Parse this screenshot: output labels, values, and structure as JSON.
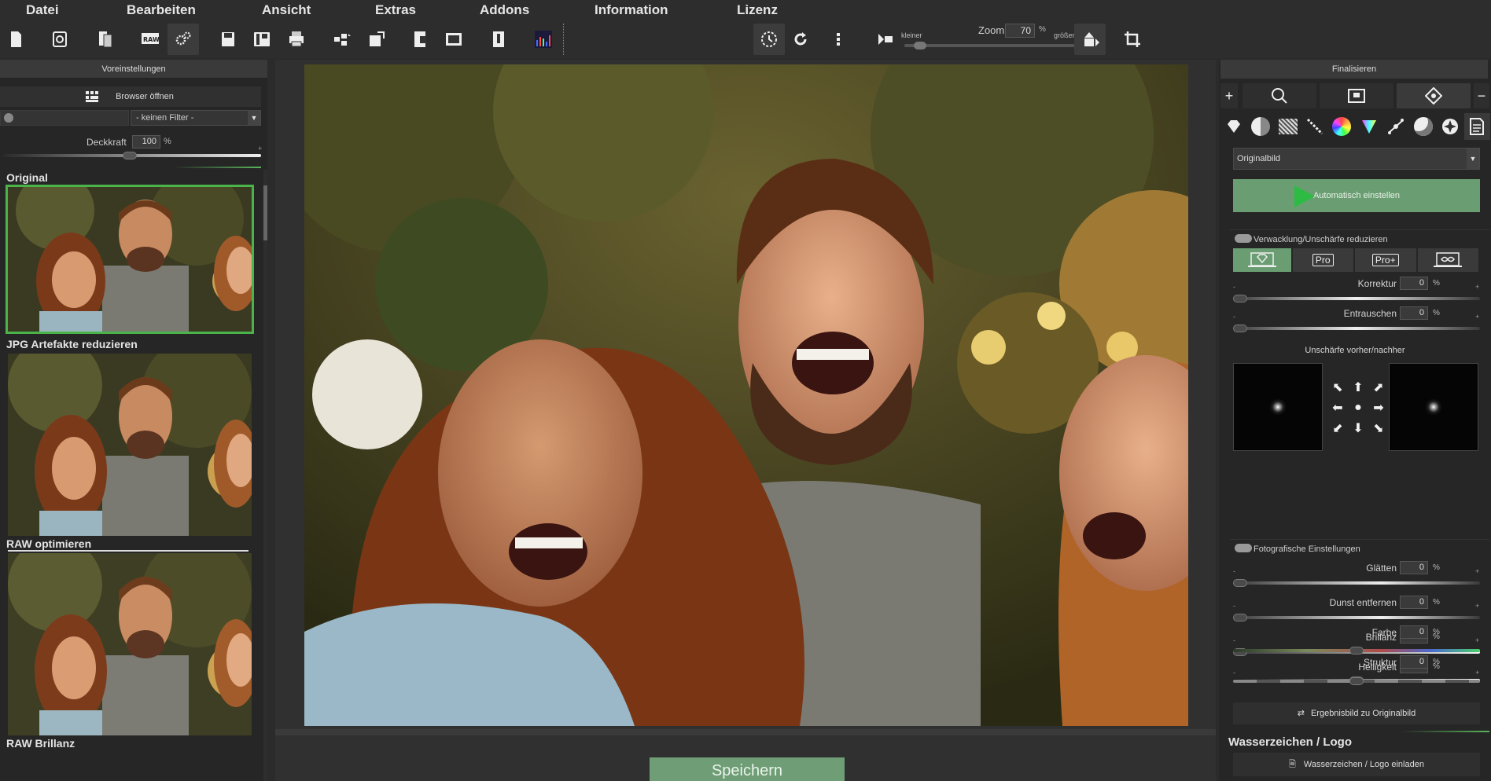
{
  "menu": {
    "items": [
      "Datei",
      "Bearbeiten",
      "Ansicht",
      "Extras",
      "Addons",
      "Information",
      "Lizenz"
    ]
  },
  "toolbar": {
    "zoom_label": "Zoom",
    "zoom_value": "70",
    "zoom_unit": "%",
    "zoom_smaller": "kleiner",
    "zoom_larger": "größer"
  },
  "left": {
    "header": "Voreinstellungen",
    "browser_button": "Browser öffnen",
    "filter_value": "- keinen Filter -",
    "opacity_label": "Deckkraft",
    "opacity_value": "100",
    "opacity_unit": "%",
    "presets": [
      {
        "name": "Original",
        "selected": true
      },
      {
        "name": "JPG Artefakte reduzieren",
        "selected": false
      },
      {
        "name": "RAW optimieren",
        "selected": false
      },
      {
        "name": "RAW Brillanz",
        "selected": false
      }
    ]
  },
  "center": {
    "save_button": "Speichern"
  },
  "right": {
    "header": "Finalisieren",
    "source_select": "Originalbild",
    "auto_button": "Automatisch einstellen",
    "blur_section": "Verwacklung/Unschärfe reduzieren",
    "modes": [
      "",
      "Pro",
      "Pro+",
      ""
    ],
    "korrektur_label": "Korrektur",
    "korrektur_value": "0",
    "entrauschen_label": "Entrauschen",
    "entrauschen_value": "0",
    "blur_preview_label": "Unschärfe vorher/nachher",
    "photo_section": "Fotografische Einstellungen",
    "params": [
      {
        "label": "Glätten",
        "value": "0"
      },
      {
        "label": "Dunst entfernen",
        "value": "0"
      },
      {
        "label": "Brillanz",
        "value": "0"
      },
      {
        "label": "Helligkeit",
        "value": "0"
      },
      {
        "label": "Farbe",
        "value": "0"
      },
      {
        "label": "Struktur",
        "value": "0"
      }
    ],
    "pct": "%",
    "minus": "-",
    "plus": "+",
    "result_button": "Ergebnisbild zu Originalbild",
    "watermark_title": "Wasserzeichen / Logo",
    "watermark_button": "Wasserzeichen / Logo einladen"
  },
  "colors": {
    "accent_green": "#6a9e72",
    "selection_green": "#4ab34a",
    "panel_bg": "#262626"
  }
}
